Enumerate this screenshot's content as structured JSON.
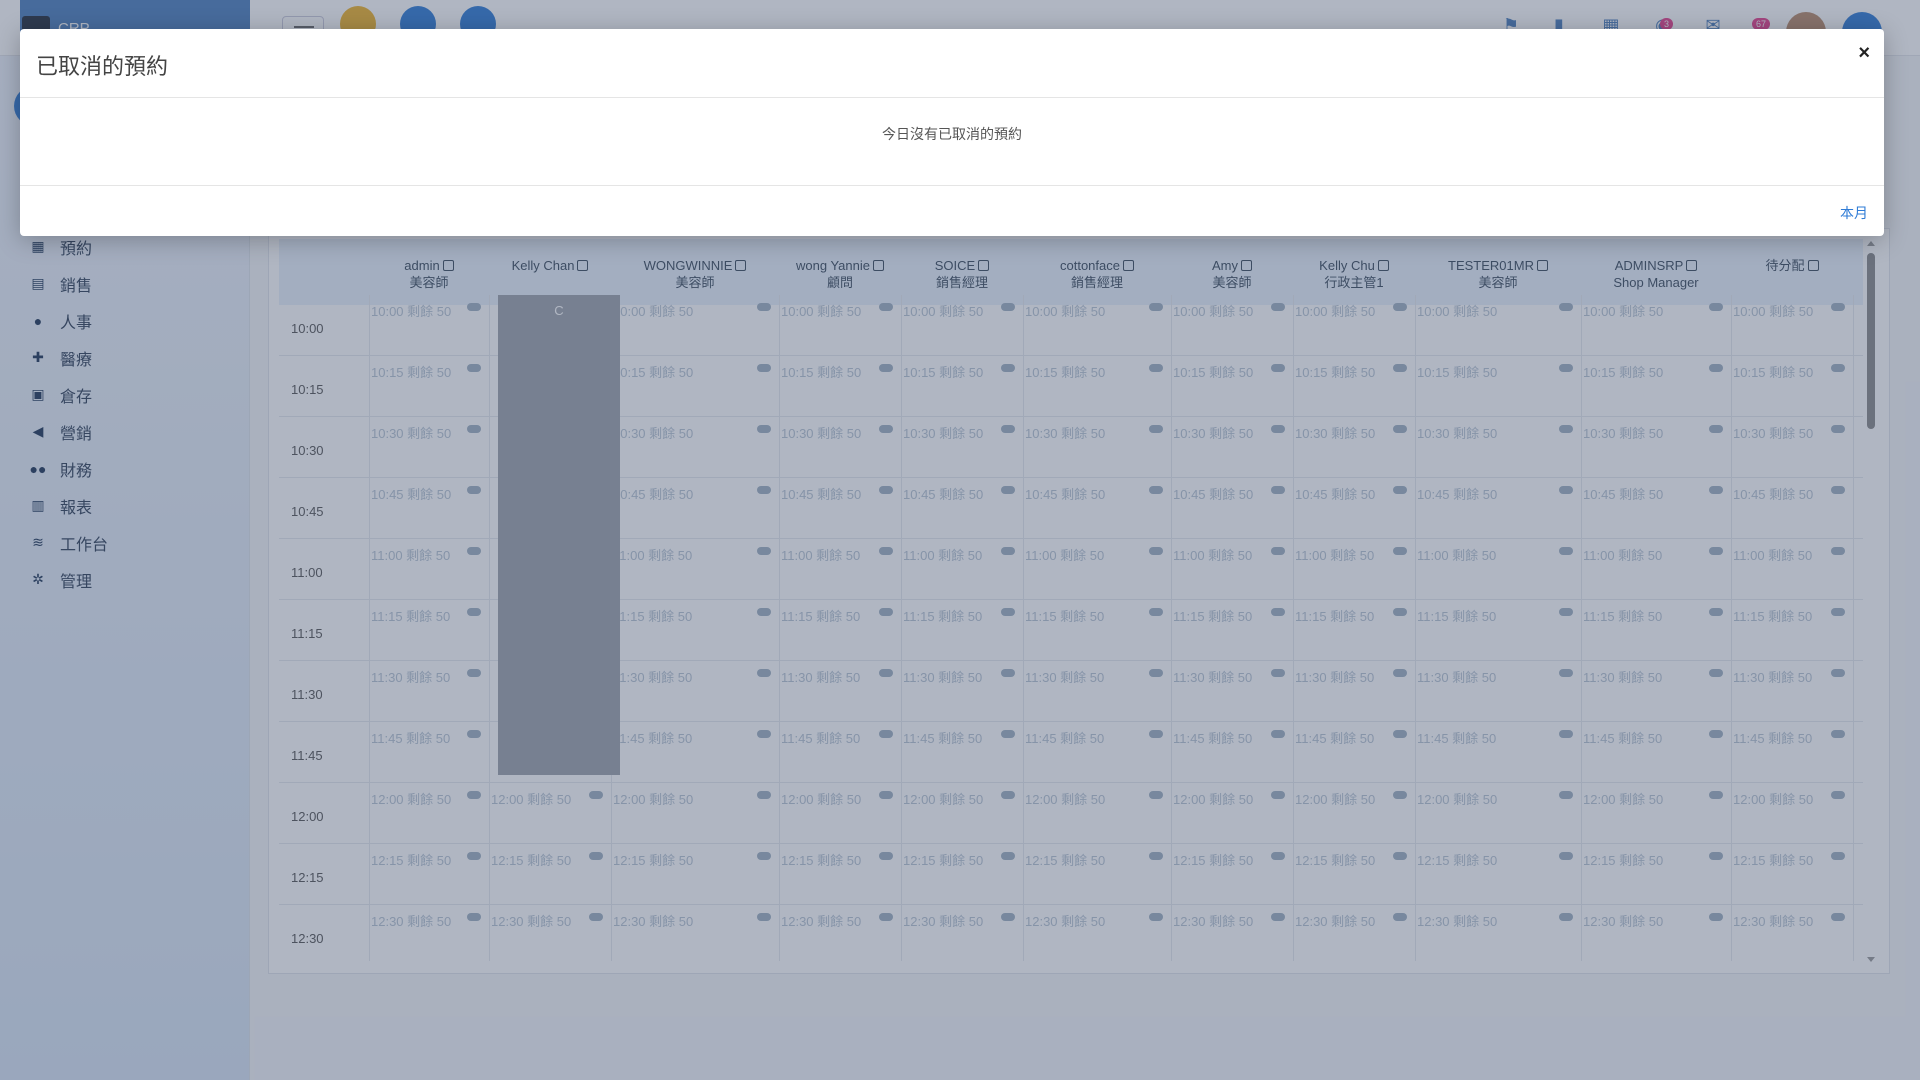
{
  "topbar": {
    "brand_text": "CRP",
    "quick_colors": [
      "#f0b429",
      "#2e7bd6",
      "#2e7bd6"
    ],
    "badges": [
      "3",
      "67"
    ],
    "accent": "#4a7fbe"
  },
  "sidebar": {
    "items": [
      {
        "label": "預約",
        "icon": "calendar-icon"
      },
      {
        "label": "銷售",
        "icon": "receipt-icon"
      },
      {
        "label": "人事",
        "icon": "person-icon"
      },
      {
        "label": "醫療",
        "icon": "medical-icon"
      },
      {
        "label": "倉存",
        "icon": "warehouse-icon"
      },
      {
        "label": "營銷",
        "icon": "megaphone-icon"
      },
      {
        "label": "財務",
        "icon": "people-icon"
      },
      {
        "label": "報表",
        "icon": "chart-icon"
      },
      {
        "label": "工作台",
        "icon": "layers-icon"
      },
      {
        "label": "管理",
        "icon": "gear-icon"
      }
    ]
  },
  "calendar": {
    "columns": [
      {
        "name": "admin",
        "role": "美容師"
      },
      {
        "name": "Kelly Chan",
        "role": ""
      },
      {
        "name": "WONGWINNIE",
        "role": "美容師"
      },
      {
        "name": "wong Yannie",
        "role": "顧問"
      },
      {
        "name": "SOICE",
        "role": "銷售經理"
      },
      {
        "name": "cottonface",
        "role": "銷售經理"
      },
      {
        "name": "Amy",
        "role": "美容師"
      },
      {
        "name": "Kelly Chu",
        "role": "行政主管1"
      },
      {
        "name": "TESTER01MR",
        "role": "美容師"
      },
      {
        "name": "ADMINSRP",
        "role": "Shop Manager"
      },
      {
        "name": "待分配",
        "role": ""
      }
    ],
    "times": [
      "10:00",
      "10:15",
      "10:30",
      "10:45",
      "11:00",
      "11:15",
      "11:30",
      "11:45",
      "12:00",
      "12:15",
      "12:30"
    ],
    "slot_suffix": "剩餘 50",
    "booking_label": "C"
  },
  "modal": {
    "title": "已取消的預約",
    "close": "×",
    "message": "今日沒有已取消的預約",
    "footer_link": "本月"
  }
}
